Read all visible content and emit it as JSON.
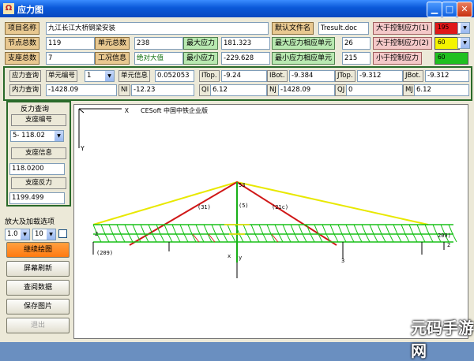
{
  "window": {
    "title": "应力图",
    "app_icon": "Ω"
  },
  "row1": {
    "project_label": "项目名称",
    "project_value": "九江长江大桥钢梁安装",
    "default_file_label": "默认文件名",
    "default_file_value": "Tresult.doc",
    "gt1_label": "大于控制应力(1)",
    "gt1_value": "195"
  },
  "row2": {
    "nodes_label": "节点总数",
    "nodes_value": "119",
    "elements_label": "单元总数",
    "elements_value": "238",
    "max_stress_label": "最大应力",
    "max_stress_value": "181.323",
    "max_stress_elem_label": "最大应力相应单元",
    "max_stress_elem_value": "26",
    "gt2_label": "大于控制应力(2)",
    "gt2_value": "60"
  },
  "row3": {
    "supports_label": "支座总数",
    "supports_value": "7",
    "case_label": "工况信息",
    "case_value": "绝对大值",
    "min_stress_label": "最小应力",
    "min_stress_value": "-229.628",
    "min_stress_elem_label": "最小应力相应单元",
    "min_stress_elem_value": "215",
    "lt_label": "小于控制应力",
    "lt_value": "60"
  },
  "colors": {
    "gt1": "#e01818",
    "gt2": "#f4f400",
    "lt": "#20c020",
    "panel_border": "#2a6a2a"
  },
  "query": {
    "stress_query_label": "应力查询",
    "elem_no_label": "单元编号",
    "elem_no_value": "1",
    "elem_info_label": "单元信息",
    "elem_info_value": "0.052053",
    "itop_label": "ITop.",
    "itop_value": "-9.24",
    "ibot_label": "IBot.",
    "ibot_value": "-9.384",
    "jtop_label": "JTop.",
    "jtop_value": "-9.312",
    "jbot_label": "JBot.",
    "jbot_value": "-9.312",
    "force_query_label": "内力查询",
    "f1_value": "-1428.09",
    "ni_label": "NI",
    "ni_value": "-12.23",
    "qi_label": "QI",
    "qi_value": "6.12",
    "nj_label": "NJ",
    "nj_value": "-1428.09",
    "qj_label": "QJ",
    "qj_value": "0",
    "mj_label": "MJ",
    "mj_value": "6.12"
  },
  "reaction": {
    "title": "反力查询",
    "support_no_label": "支座编号",
    "support_no_value": "5- 118.02",
    "support_info_label": "支座信息",
    "support_info_value": "118.0200",
    "support_force_label": "支座反力",
    "support_force_value": "1199.499"
  },
  "zoom": {
    "label": "放大及加载选项",
    "scale_value": "1.0",
    "load_value": "10"
  },
  "buttons": {
    "redraw": "继续绘图",
    "refresh": "屏幕刷新",
    "view_data": "查阅数据",
    "save_image": "保存图片",
    "exit": "退出"
  },
  "canvas": {
    "title": "CESoft 中国中铁企业版",
    "x_axis": "X",
    "y_axis": "Y",
    "labels": {
      "n53": "53",
      "n5": "(5)",
      "n31": "(31)",
      "n21": "(21c)",
      "l209": "(209)",
      "r209": "209)",
      "l2": "2",
      "r2": "2",
      "l3": "3",
      "x": "x",
      "yy": "y"
    }
  },
  "watermark": "元码手游网"
}
